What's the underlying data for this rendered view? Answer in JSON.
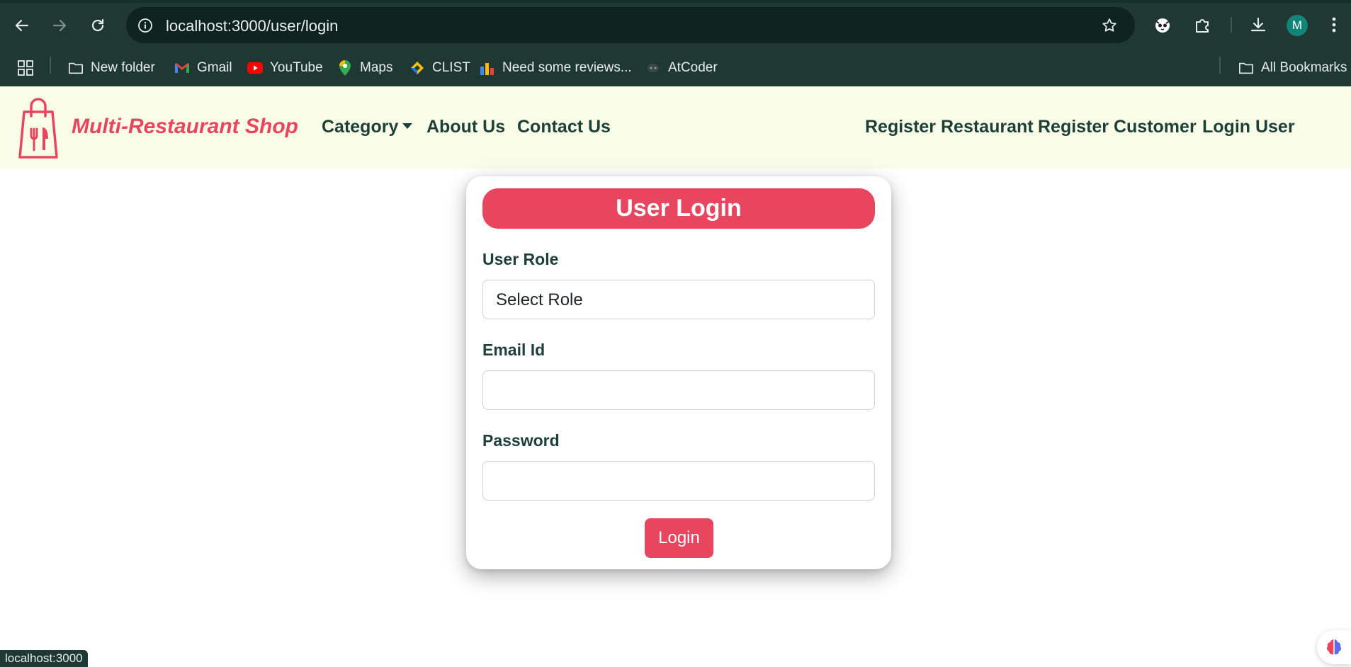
{
  "browser": {
    "url": "localhost:3000/user/login",
    "profile_initial": "M",
    "status_url": "localhost:3000",
    "bookmarks": [
      {
        "label": "New folder",
        "icon": "folder-icon"
      },
      {
        "label": "Gmail",
        "icon": "gmail-icon"
      },
      {
        "label": "YouTube",
        "icon": "youtube-icon"
      },
      {
        "label": "Maps",
        "icon": "maps-icon"
      },
      {
        "label": "CLIST",
        "icon": "clist-icon"
      },
      {
        "label": "Need some reviews...",
        "icon": "bar-chart-icon"
      },
      {
        "label": "AtCoder",
        "icon": "atcoder-icon"
      }
    ],
    "all_bookmarks_label": "All Bookmarks"
  },
  "navbar": {
    "brand": "Multi-Restaurant Shop",
    "left_links": {
      "category": "Category",
      "about": "About Us",
      "contact": "Contact Us"
    },
    "right_links": {
      "register_restaurant": "Register Restaurant",
      "register_customer": "Register Customer",
      "login_user": "Login User"
    }
  },
  "login_form": {
    "title": "User Login",
    "role_label": "User Role",
    "role_selected": "Select Role",
    "email_label": "Email Id",
    "email_value": "",
    "password_label": "Password",
    "password_value": "",
    "submit_label": "Login"
  },
  "colors": {
    "accent": "#e8455f",
    "navbar_bg": "#f9fde8",
    "nav_text": "#1e3f38",
    "chrome_bg": "#1f3834"
  }
}
